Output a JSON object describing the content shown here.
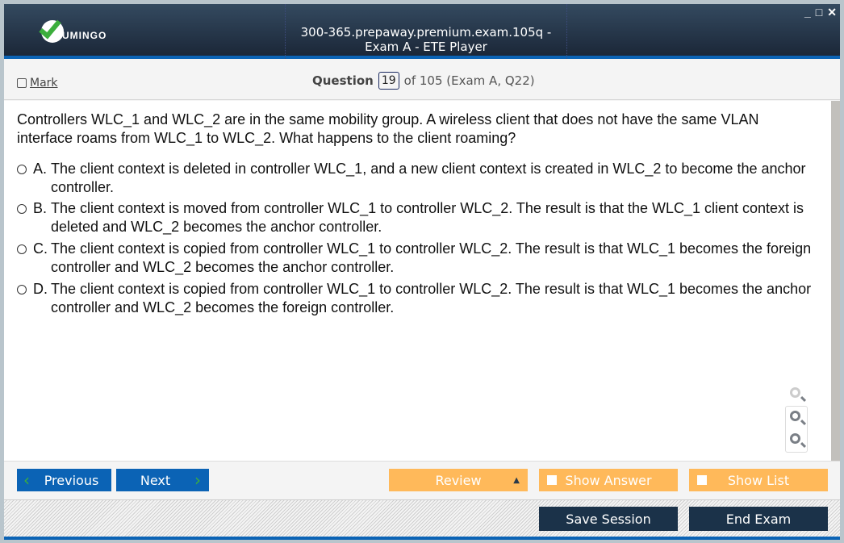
{
  "window": {
    "title": "300-365.prepaway.premium.exam.105q - Exam A - ETE Player",
    "logo_text": "UMINGO",
    "controls": [
      "_",
      "□",
      "✕"
    ]
  },
  "toolbar": {
    "mark_label": "Mark",
    "question_label": "Question",
    "question_number": "19",
    "question_total": "of 105 (Exam A, Q22)"
  },
  "question": {
    "text": "Controllers WLC_1 and WLC_2 are in the same mobility group. A wireless client that does not have the same VLAN interface roams from WLC_1 to WLC_2. What happens to the client roaming?",
    "options": [
      {
        "letter": "A.",
        "text": "The client context is deleted in controller WLC_1, and a new client context is created in WLC_2 to become the anchor controller."
      },
      {
        "letter": "B.",
        "text": "The client context is moved from controller WLC_1 to controller WLC_2. The result is that the WLC_1 client context is deleted and WLC_2 becomes the anchor controller."
      },
      {
        "letter": "C.",
        "text": "The client context is copied from controller WLC_1 to controller WLC_2. The result is that WLC_1 becomes the foreign controller and WLC_2 becomes the anchor controller."
      },
      {
        "letter": "D.",
        "text": "The client context is copied from controller WLC_1 to controller WLC_2. The result is that WLC_1 becomes the anchor controller and WLC_2 becomes the foreign controller."
      }
    ]
  },
  "nav": {
    "previous": "Previous",
    "next": "Next",
    "review": "Review",
    "show_answer": "Show Answer",
    "show_list": "Show List",
    "save_session": "Save Session",
    "end_exam": "End Exam"
  }
}
